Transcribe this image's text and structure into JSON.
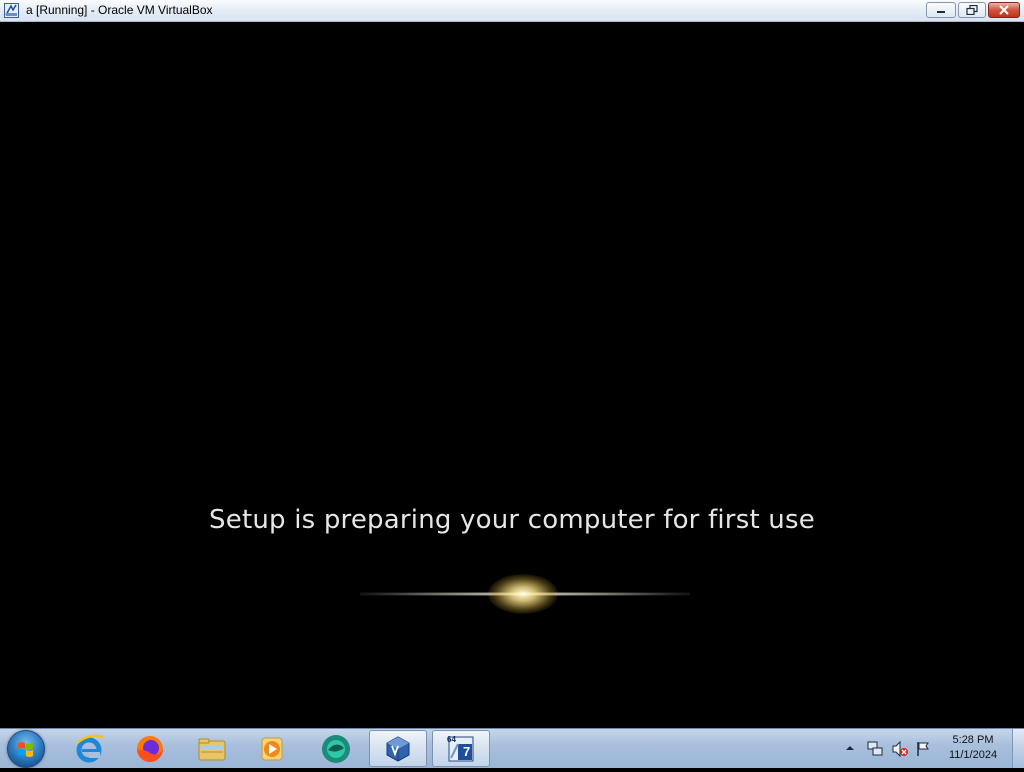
{
  "window": {
    "title": "a [Running] - Oracle VM VirtualBox",
    "icon": "virtualbox-icon",
    "controls": [
      "minimize-icon",
      "restore-icon",
      "close-icon"
    ]
  },
  "vm_screen": {
    "message": "Setup is preparing your computer for first use",
    "animation": "glow-progress"
  },
  "taskbar": {
    "start_icon": "windows-start-orb",
    "pinned": [
      {
        "name": "internet-explorer",
        "icon": "ie-icon"
      },
      {
        "name": "firefox",
        "icon": "firefox-icon"
      },
      {
        "name": "windows-explorer",
        "icon": "folder-icon"
      },
      {
        "name": "media-player",
        "icon": "media-player-icon"
      },
      {
        "name": "app-circle",
        "icon": "green-circle-icon"
      },
      {
        "name": "virtualbox",
        "icon": "virtualbox-icon",
        "active": true
      },
      {
        "name": "vm-win7-64",
        "icon": "win7-64-icon",
        "active": true,
        "badge": "64",
        "badge2": "7"
      }
    ],
    "tray_icons": [
      "show-hidden-icons-icon",
      "network-icon",
      "volume-muted-icon",
      "action-center-flag-icon"
    ],
    "clock": {
      "time": "5:28 PM",
      "date": "11/1/2024"
    }
  },
  "colors": {
    "vm_background": "#000000",
    "taskbar": "#a9c0dd",
    "close_button": "#c2321b"
  }
}
